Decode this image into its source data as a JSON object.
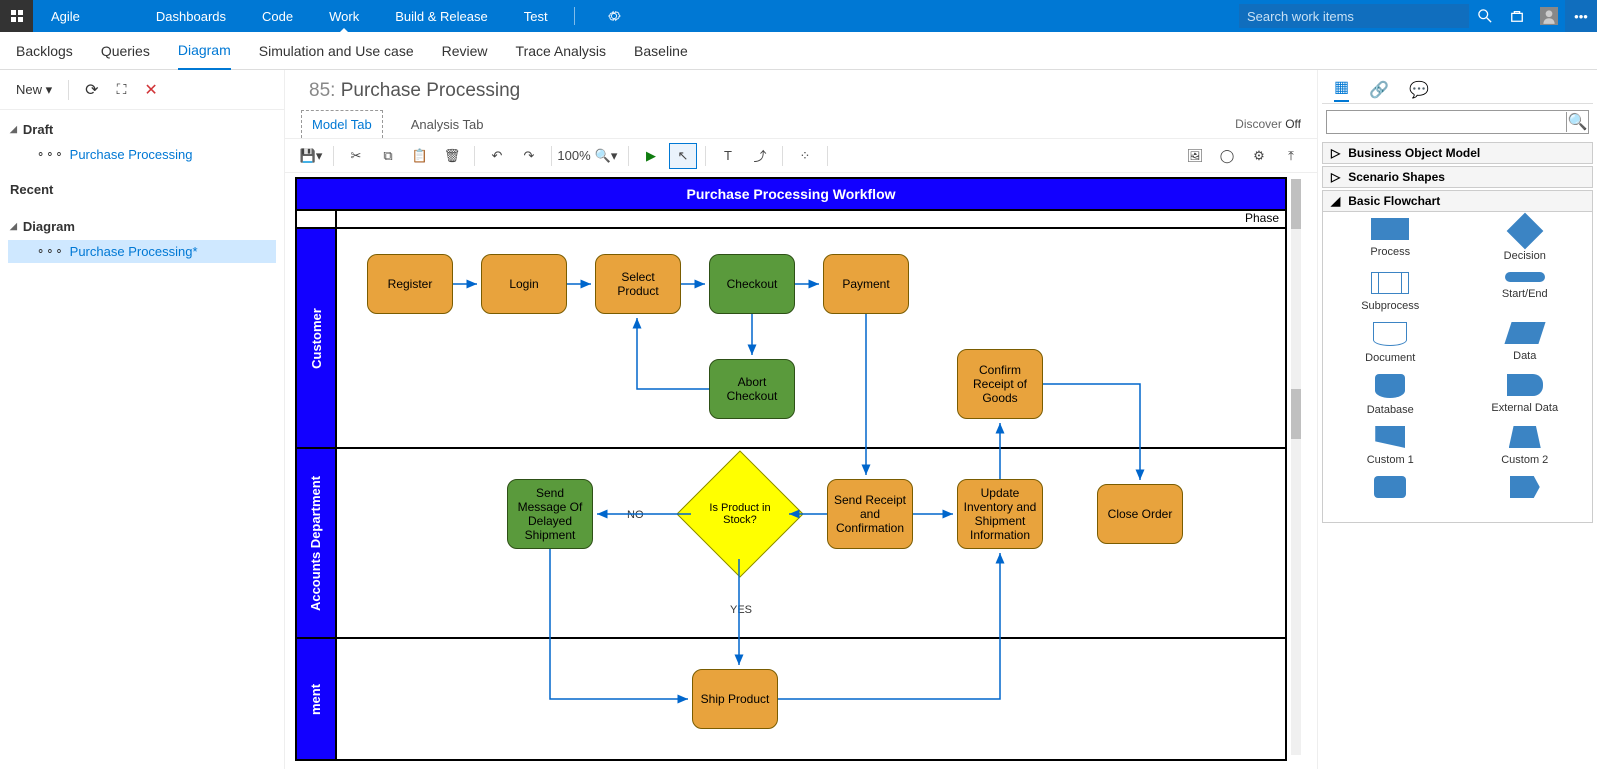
{
  "topnav": {
    "brand": "Agile",
    "tabs": [
      "Dashboards",
      "Code",
      "Work",
      "Build & Release",
      "Test"
    ],
    "active_tab_index": 2,
    "search_placeholder": "Search work items"
  },
  "subnav": {
    "items": [
      "Backlogs",
      "Queries",
      "Diagram",
      "Simulation and Use case",
      "Review",
      "Trace Analysis",
      "Baseline"
    ],
    "active_index": 2
  },
  "left": {
    "new_label": "New",
    "groups": [
      {
        "title": "Draft",
        "items": [
          {
            "label": "Purchase Processing",
            "selected": false
          }
        ]
      },
      {
        "title": "Recent",
        "items": []
      },
      {
        "title": "Diagram",
        "items": [
          {
            "label": "Purchase Processing*",
            "selected": true
          }
        ]
      }
    ]
  },
  "doc": {
    "id": "85",
    "title": "Purchase Processing"
  },
  "model_tabs": {
    "items": [
      "Model Tab",
      "Analysis Tab"
    ],
    "active": 0
  },
  "discover": {
    "label": "Discover",
    "state": "Off"
  },
  "editor_toolbar": {
    "zoom": "100%"
  },
  "diagram": {
    "title": "Purchase Processing Workflow",
    "phase_label": "Phase",
    "lanes": [
      {
        "name": "Customer"
      },
      {
        "name": "Accounts Department"
      },
      {
        "name": "ment"
      }
    ],
    "nodes": {
      "register": "Register",
      "login": "Login",
      "select": "Select Product",
      "checkout": "Checkout",
      "payment": "Payment",
      "abort": "Abort Checkout",
      "confirm_receipt": "Confirm Receipt of Goods",
      "send_delay": "Send Message Of Delayed Shipment",
      "instock": "Is Product in Stock?",
      "send_receipt": "Send Receipt and Confirmation",
      "update_inv": "Update Inventory and Shipment Information",
      "close": "Close Order",
      "ship": "Ship Product"
    },
    "edge_labels": {
      "no": "NO",
      "yes": "YES"
    }
  },
  "right_panel": {
    "sections": [
      {
        "title": "Business Object Model",
        "open": false
      },
      {
        "title": "Scenario Shapes",
        "open": false
      },
      {
        "title": "Basic Flowchart",
        "open": true
      }
    ],
    "shapes": [
      "Process",
      "Decision",
      "Subprocess",
      "Start/End",
      "Document",
      "Data",
      "Database",
      "External Data",
      "Custom 1",
      "Custom 2"
    ]
  }
}
